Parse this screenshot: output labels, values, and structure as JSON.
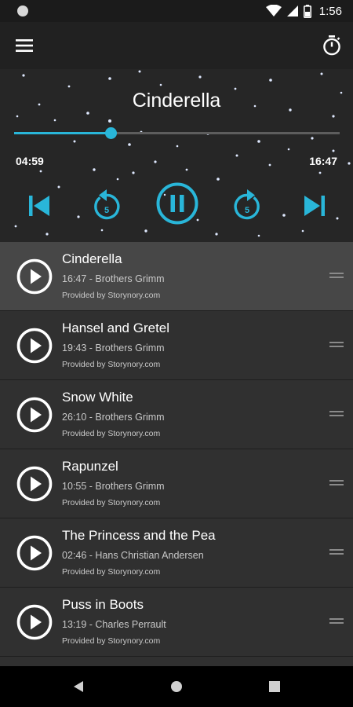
{
  "status_bar": {
    "time": "1:56"
  },
  "colors": {
    "accent": "#29b6d9",
    "active_row": "#474747",
    "list_bg": "#303030"
  },
  "icons": {
    "menu": "hamburger-icon",
    "timer": "stopwatch-icon",
    "prev": "skip-previous-icon",
    "rewind": "replay-5-icon",
    "pause": "pause-circle-icon",
    "forward": "forward-5-icon",
    "next": "skip-next-icon",
    "row_play": "play-circle-icon",
    "drag": "drag-handle-icon"
  },
  "player": {
    "title": "Cinderella",
    "elapsed": "04:59",
    "total": "16:47",
    "progress": 0.297,
    "skip_seconds": "5"
  },
  "stories": [
    {
      "title": "Cinderella",
      "meta": "16:47 - Brothers Grimm",
      "provider": "Provided by Storynory.com",
      "active": true
    },
    {
      "title": "Hansel and Gretel",
      "meta": "19:43 - Brothers Grimm",
      "provider": "Provided by Storynory.com",
      "active": false
    },
    {
      "title": "Snow White",
      "meta": "26:10 - Brothers Grimm",
      "provider": "Provided by Storynory.com",
      "active": false
    },
    {
      "title": "Rapunzel",
      "meta": "10:55 - Brothers Grimm",
      "provider": "Provided by Storynory.com",
      "active": false
    },
    {
      "title": "The Princess and the Pea",
      "meta": "02:46 - Hans Christian Andersen",
      "provider": "Provided by Storynory.com",
      "active": false
    },
    {
      "title": "Puss in Boots",
      "meta": "13:19 - Charles Perrault",
      "provider": "Provided by Storynory.com",
      "active": false
    }
  ]
}
